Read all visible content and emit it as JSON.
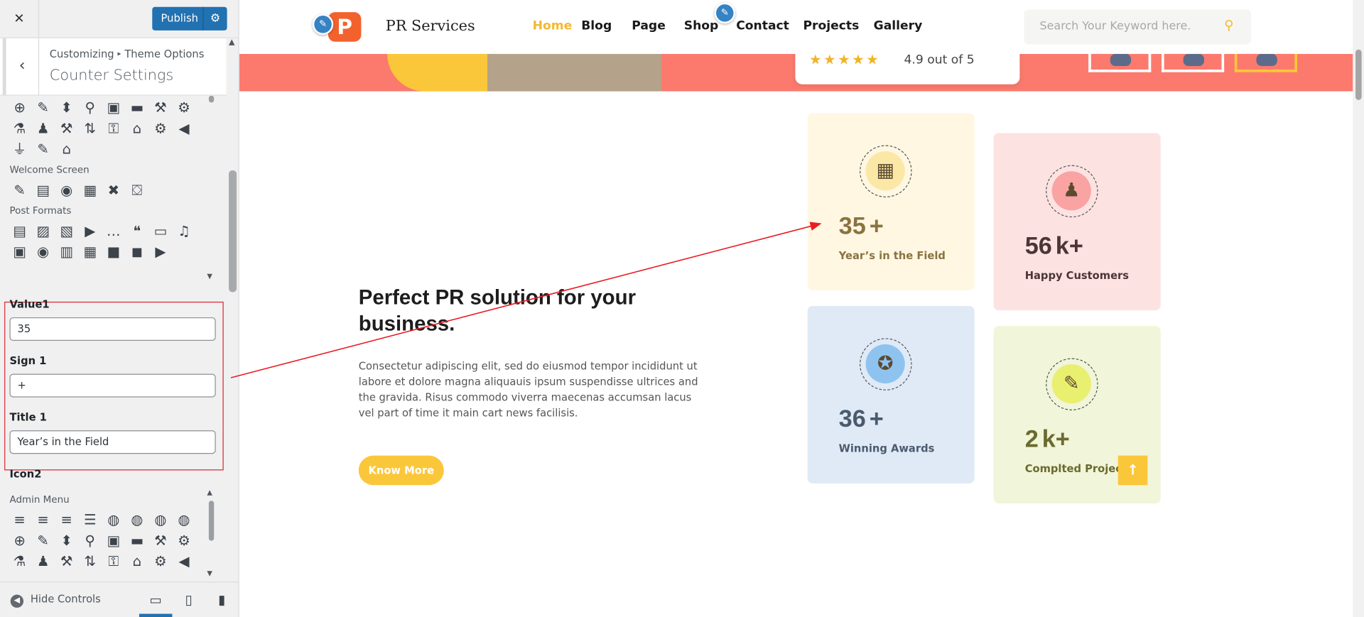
{
  "sidebar": {
    "close_icon": "close-icon",
    "publish_label": "Publish",
    "breadcrumb_root": "Customizing",
    "breadcrumb_child": "Theme Options",
    "section_title": "Counter Settings",
    "group_top": {
      "icons": [
        "⊕",
        "✎",
        "⬍",
        "⚲",
        "▣",
        "▬",
        "⚒",
        "⚙",
        "⚗",
        "♟",
        "⚒",
        "⇅",
        "⚿",
        "⌂",
        "⚙",
        "◀",
        "⏚",
        "✎",
        "⌂"
      ]
    },
    "welcome_label": "Welcome Screen",
    "welcome_icons": [
      "✎",
      "▤",
      "◉",
      "▦",
      "✖",
      "⛋"
    ],
    "post_formats_label": "Post Formats",
    "post_formats_icons": [
      "▤",
      "▨",
      "▧",
      "▶",
      "…",
      "❝",
      "▭",
      "♫",
      "▣",
      "◉",
      "▥",
      "▦",
      "■",
      "◼",
      "▶"
    ],
    "fields": [
      {
        "label": "Value1",
        "value": "35"
      },
      {
        "label": "Sign 1",
        "value": "+"
      },
      {
        "label": "Title 1",
        "value": "Year’s in the Field"
      }
    ],
    "icon2_label": "Icon2",
    "admin_menu_label": "Admin Menu",
    "admin_icons": [
      "≡",
      "≡",
      "≡",
      "☰",
      "◍",
      "◍",
      "◍",
      "◍",
      "⊕",
      "✎",
      "⬍",
      "⚲",
      "▣",
      "▬",
      "⚒",
      "⚙",
      "⚗",
      "♟",
      "⚒",
      "⇅",
      "⚿",
      "⌂",
      "⚙",
      "◀"
    ],
    "hide_controls": "Hide Controls",
    "devices": [
      "desktop-icon",
      "tablet-icon",
      "mobile-icon"
    ]
  },
  "preview": {
    "logo_text": "PR Services",
    "menu": [
      "Home",
      "Blog",
      "Page",
      "Shop",
      "Contact",
      "Projects",
      "Gallery"
    ],
    "active_menu": "Home",
    "search_placeholder": "Search Your Keyword here.",
    "rating_stars": "★★★★★",
    "rating_text": "4.9 out of 5",
    "heading": "Perfect PR solution for your business.",
    "paragraph": "Consectetur adipiscing elit, sed do eiusmod tempor incididunt ut labore et dolore magna aliquauis ipsum suspendisse ultrices and the gravida. Risus commodo viverra maecenas accumsan lacus vel part of time it main cart news facilisis.",
    "button": "Know More",
    "counters": [
      {
        "value": "35",
        "sign": "+",
        "title": "Year’s in the Field",
        "icon": "calendar-icon",
        "glyph": "▦",
        "bg": "#fff7e2",
        "circle": "#fbe7a6",
        "title_color": "#8a7340"
      },
      {
        "value": "56",
        "sign": "k+",
        "title": "Happy Customers",
        "icon": "users-icon",
        "glyph": "♟",
        "bg": "#fde2e2",
        "circle": "#f9a3a3",
        "title_color": "#4c3535"
      },
      {
        "value": "36",
        "sign": "+",
        "title": "Winning Awards",
        "icon": "award-icon",
        "glyph": "✪",
        "bg": "#dfeaf6",
        "circle": "#8ec3ef",
        "title_color": "#4a5a6e"
      },
      {
        "value": "2",
        "sign": "k+",
        "title": "Complted Projects",
        "icon": "edit-icon",
        "glyph": "✎",
        "bg": "#f1f5d9",
        "circle": "#e9ef6e",
        "title_color": "#6b6a2f"
      }
    ],
    "to_top_icon": "arrow-up-icon"
  },
  "colors": {
    "accent": "#fbc73a",
    "publish": "#2271b1",
    "hero": "#fb7a6d",
    "annotation": "#d9272e"
  }
}
